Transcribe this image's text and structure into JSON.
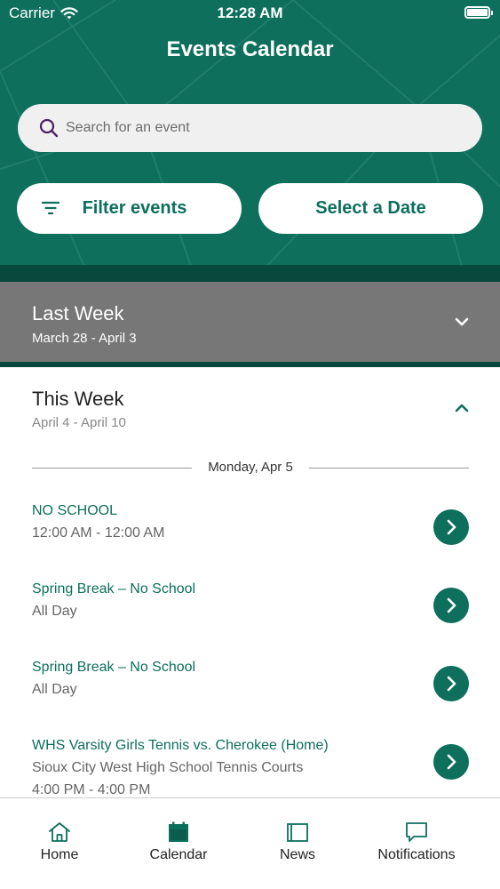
{
  "status_bar": {
    "carrier": "Carrier",
    "time": "12:28 AM"
  },
  "header": {
    "title": "Events Calendar",
    "search_placeholder": "Search for an event",
    "filter_label": "Filter events",
    "date_label": "Select a Date"
  },
  "last_week": {
    "title": "Last Week",
    "range": "March 28 - April 3",
    "expanded": false
  },
  "this_week": {
    "title": "This Week",
    "range": "April 4 - April 10",
    "expanded": true,
    "day_label": "Monday, Apr 5",
    "events": [
      {
        "name": "NO SCHOOL",
        "line2": "12:00 AM - 12:00 AM",
        "line3": ""
      },
      {
        "name": "Spring Break – No School",
        "line2": "All Day",
        "line3": ""
      },
      {
        "name": "Spring Break – No School",
        "line2": "All Day",
        "line3": ""
      },
      {
        "name": "WHS Varsity Girls Tennis vs. Cherokee (Home)",
        "line2": "Sioux City West High School Tennis Courts",
        "line3": "4:00 PM - 4:00 PM"
      }
    ]
  },
  "tabs": [
    {
      "label": "Home",
      "icon": "home-icon"
    },
    {
      "label": "Calendar",
      "icon": "calendar-icon",
      "active": true
    },
    {
      "label": "News",
      "icon": "news-icon"
    },
    {
      "label": "Notifications",
      "icon": "chat-bubble-icon"
    }
  ],
  "colors": {
    "brand": "#0d6f5c",
    "brand_dark": "#07493d",
    "collapsed_section": "#777777"
  }
}
